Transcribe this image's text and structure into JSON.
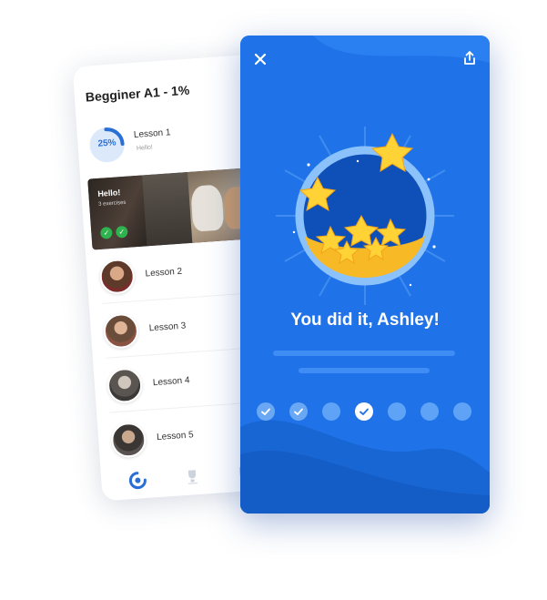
{
  "course": {
    "title": "Begginer A1 - 1%",
    "progress_percent": 25,
    "progress_label": "25%",
    "lesson1_name": "Lesson 1",
    "lesson1_sub": "Hello!"
  },
  "hello_card": {
    "title": "Hello!",
    "subtitle": "3 exercises"
  },
  "lessons": [
    {
      "label": "Lesson 2"
    },
    {
      "label": "Lesson 3"
    },
    {
      "label": "Lesson 4"
    },
    {
      "label": "Lesson 5"
    }
  ],
  "tabs": [
    "learn-icon",
    "trophy-icon",
    "chat-icon"
  ],
  "modal": {
    "headline": "You did it, Ashley!",
    "steps": [
      {
        "state": "done"
      },
      {
        "state": "done"
      },
      {
        "state": "todo"
      },
      {
        "state": "current"
      },
      {
        "state": "todo"
      },
      {
        "state": "todo"
      },
      {
        "state": "todo"
      }
    ]
  },
  "colors": {
    "modal_blue": "#1f72e8",
    "accent": "#2a6fd6",
    "success": "#2fb34e",
    "star": "#ffd236"
  }
}
